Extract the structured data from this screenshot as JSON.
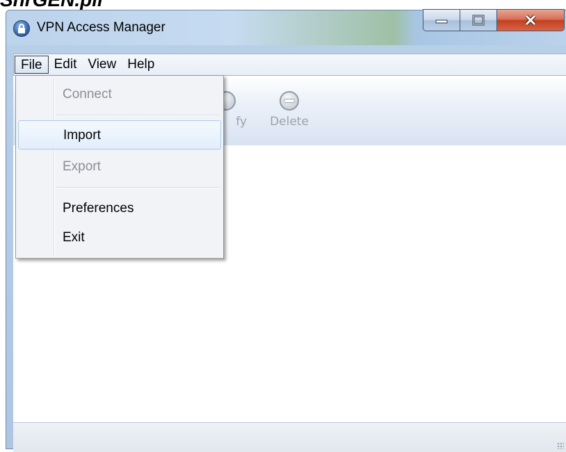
{
  "caption": "ShrGEN.pii",
  "window": {
    "title": "VPN Access Manager"
  },
  "menubar": {
    "file": "File",
    "edit": "Edit",
    "view": "View",
    "help": "Help"
  },
  "toolbar": {
    "modify_label": "fy",
    "delete_label": "Delete"
  },
  "file_menu": {
    "connect": "Connect",
    "import": "Import",
    "export": "Export",
    "preferences": "Preferences",
    "exit": "Exit"
  },
  "colors": {
    "accent_title": "#bcd3ec",
    "close_button": "#c2401f",
    "menu_hover": "#a8cbef"
  }
}
